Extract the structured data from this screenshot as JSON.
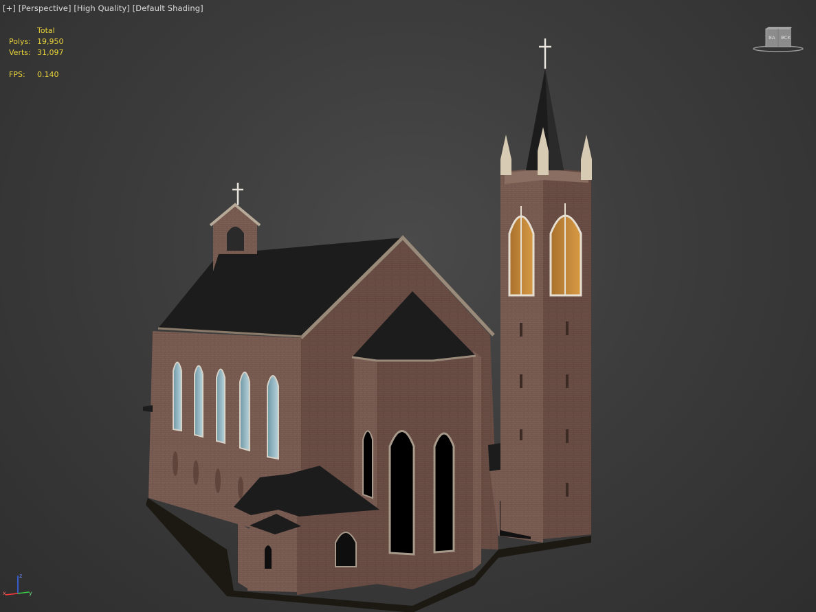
{
  "viewport": {
    "menus": {
      "plus": "[+]",
      "view": "[Perspective]",
      "quality": "[High Quality]",
      "shading": "[Default Shading]"
    },
    "stats": {
      "header": "Total",
      "polys_label": "Polys:",
      "polys_value": "19,950",
      "verts_label": "Verts:",
      "verts_value": "31,097",
      "fps_label": "FPS:",
      "fps_value": "0.140"
    },
    "axis": {
      "z": "z",
      "x": "x",
      "y": "y"
    }
  },
  "colors": {
    "background": "#3c3c3c",
    "stats_text": "#e8d33a",
    "label_text": "#dcdcdc",
    "brick": "#7d5f55",
    "roof": "#1e1e1e",
    "window_glass": "#8fb4c0",
    "window_amber": "#c48a3a"
  },
  "icons": [
    "viewcube-icon",
    "axis-tripod-icon",
    "cross-icon"
  ]
}
